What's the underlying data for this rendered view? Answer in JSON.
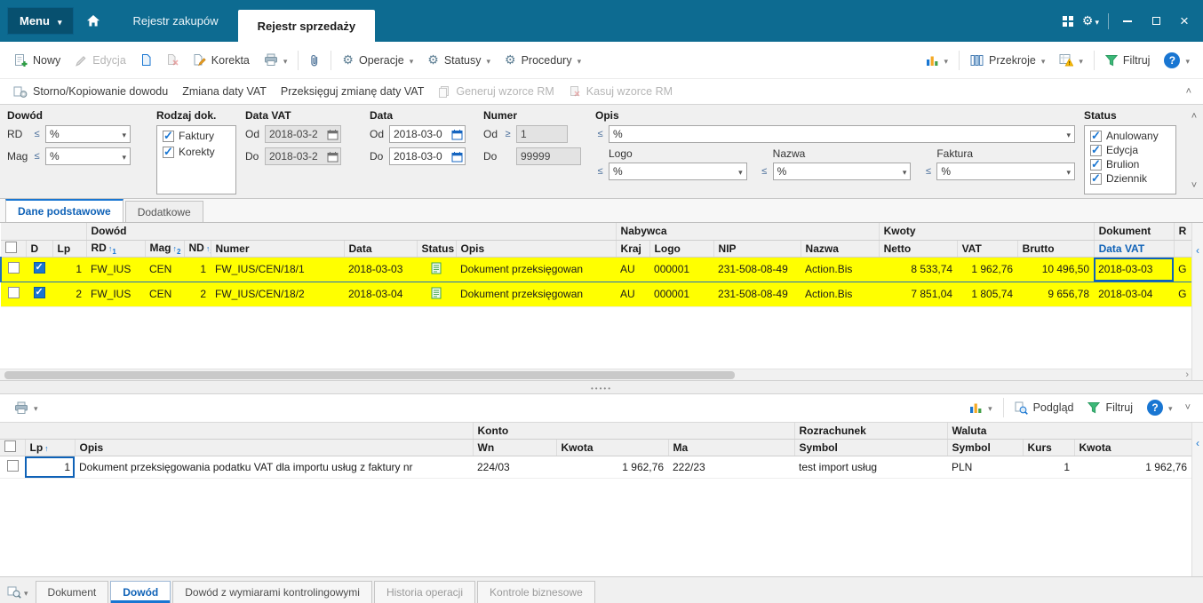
{
  "colors": {
    "topbar": "#0d6b91",
    "accent": "#1976d2",
    "row_highlight": "#ffff00"
  },
  "topbar": {
    "menu_label": "Menu",
    "tabs": [
      {
        "label": "Rejestr zakupów"
      },
      {
        "label": "Rejestr sprzedaży"
      }
    ]
  },
  "toolbar": {
    "nowy": "Nowy",
    "edycja": "Edycja",
    "korekta": "Korekta",
    "operacje": "Operacje",
    "statusy": "Statusy",
    "procedury": "Procedury",
    "przekroje": "Przekroje",
    "filtruj": "Filtruj",
    "help": "?"
  },
  "toolbar2": {
    "storno": "Storno/Kopiowanie dowodu",
    "zmiana_daty": "Zmiana daty VAT",
    "przeksieguj": "Przeksięguj zmianę daty VAT",
    "generuj": "Generuj wzorce RM",
    "kasuj": "Kasuj wzorce RM"
  },
  "filters": {
    "dowod": {
      "title": "Dowód",
      "rd_label": "RD",
      "rd_op": "≤",
      "rd_value": "%",
      "mag_label": "Mag",
      "mag_op": "≤",
      "mag_value": "%"
    },
    "rodzaj": {
      "title": "Rodzaj dok.",
      "options": [
        {
          "label": "Faktury",
          "checked": true
        },
        {
          "label": "Korekty",
          "checked": true
        }
      ]
    },
    "data_vat": {
      "title": "Data VAT",
      "od_label": "Od",
      "od_value": "2018-03-2",
      "do_label": "Do",
      "do_value": "2018-03-2"
    },
    "data": {
      "title": "Data",
      "od_label": "Od",
      "od_value": "2018-03-0",
      "do_label": "Do",
      "do_value": "2018-03-0"
    },
    "numer": {
      "title": "Numer",
      "od_label": "Od",
      "od_op": "≥",
      "od_value": "1",
      "do_label": "Do",
      "do_value": "99999"
    },
    "opis": {
      "title": "Opis",
      "op": "≤",
      "value": "%",
      "logo_label": "Logo",
      "logo_op": "≤",
      "logo_value": "%",
      "nazwa_label": "Nazwa",
      "nazwa_op": "≤",
      "nazwa_value": "%",
      "faktura_label": "Faktura",
      "faktura_op": "≤",
      "faktura_value": "%"
    },
    "status": {
      "title": "Status",
      "options": [
        {
          "label": "Anulowany",
          "checked": true
        },
        {
          "label": "Edycja",
          "checked": true
        },
        {
          "label": "Brulion",
          "checked": true
        },
        {
          "label": "Dziennik",
          "checked": true
        }
      ]
    }
  },
  "grid_tabs": [
    {
      "label": "Dane podstawowe"
    },
    {
      "label": "Dodatkowe"
    }
  ],
  "main_table": {
    "groups": {
      "dowod": "Dowód",
      "nabywca": "Nabywca",
      "kwoty": "Kwoty",
      "dokument": "Dokument",
      "r": "R"
    },
    "columns": {
      "d": "D",
      "lp": "Lp",
      "rd": "RD",
      "mag": "Mag",
      "nd": "ND",
      "numer": "Numer",
      "data": "Data",
      "status": "Status",
      "opis": "Opis",
      "kraj": "Kraj",
      "logo": "Logo",
      "nip": "NIP",
      "nazwa": "Nazwa",
      "netto": "Netto",
      "vat": "VAT",
      "brutto": "Brutto",
      "data_vat": "Data VAT"
    },
    "sort": {
      "rd": "1",
      "mag": "2",
      "nd": "3"
    },
    "rows": [
      {
        "lp": "1",
        "rd": "FW_IUS",
        "mag": "CEN",
        "nd": "1",
        "numer": "FW_IUS/CEN/18/1",
        "data": "2018-03-03",
        "opis": "Dokument przeksięgowan",
        "kraj": "AU",
        "logo": "000001",
        "nip": "231-508-08-49",
        "nazwa": "Action.Bis",
        "netto": "8 533,74",
        "vat": "1 962,76",
        "brutto": "10 496,50",
        "data_vat": "2018-03-03",
        "r": "G"
      },
      {
        "lp": "2",
        "rd": "FW_IUS",
        "mag": "CEN",
        "nd": "2",
        "numer": "FW_IUS/CEN/18/2",
        "data": "2018-03-04",
        "opis": "Dokument przeksięgowan",
        "kraj": "AU",
        "logo": "000001",
        "nip": "231-508-08-49",
        "nazwa": "Action.Bis",
        "netto": "7 851,04",
        "vat": "1 805,74",
        "brutto": "9 656,78",
        "data_vat": "2018-03-04",
        "r": "G"
      }
    ]
  },
  "detail": {
    "toolbar": {
      "podglad": "Podgląd",
      "filtruj": "Filtruj",
      "help": "?"
    },
    "table": {
      "groups": {
        "konto": "Konto",
        "rozrachunek": "Rozrachunek",
        "waluta": "Waluta"
      },
      "columns": {
        "lp": "Lp",
        "opis": "Opis",
        "wn": "Wn",
        "kwota": "Kwota",
        "ma": "Ma",
        "symbol": "Symbol",
        "waluta_symbol": "Symbol",
        "kurs": "Kurs",
        "waluta_kwota": "Kwota"
      },
      "rows": [
        {
          "lp": "1",
          "opis": "Dokument przeksięgowania podatku VAT dla importu usług z faktury nr",
          "wn": "224/03",
          "kwota": "1 962,76",
          "ma": "222/23",
          "symbol": "test import usług",
          "waluta_symbol": "PLN",
          "kurs": "1",
          "waluta_kwota": "1 962,76"
        }
      ]
    }
  },
  "bottom_tabs": [
    {
      "label": "Dokument"
    },
    {
      "label": "Dowód"
    },
    {
      "label": "Dowód z wymiarami kontrolingowymi"
    },
    {
      "label": "Historia operacji"
    },
    {
      "label": "Kontrole biznesowe"
    }
  ]
}
